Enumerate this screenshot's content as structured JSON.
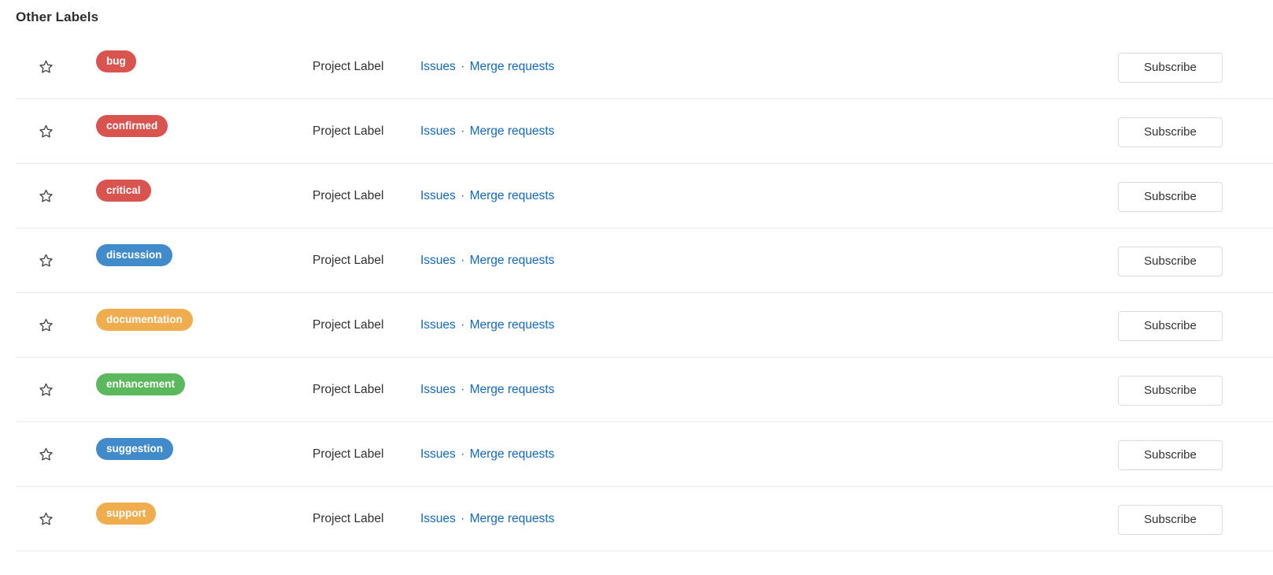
{
  "section": {
    "title": "Other Labels"
  },
  "colors": {
    "red": "#d9534f",
    "blue": "#428bca",
    "orange": "#f0ad4e",
    "green": "#5cb85c",
    "link": "#1068bf",
    "text": "#303030",
    "divider": "#e9e9e9",
    "button_border": "#dbdbdb"
  },
  "row_common": {
    "type_text": "Project Label",
    "issues_link": "Issues",
    "separator": "·",
    "merge_requests_link": "Merge requests",
    "subscribe_label": "Subscribe",
    "star_icon": "star-outline-icon",
    "promote_icon": "promote-arrow-up-icon",
    "edit_icon": "pencil-icon",
    "delete_icon": "trash-icon"
  },
  "labels": [
    {
      "name": "bug",
      "color": "#d9534f"
    },
    {
      "name": "confirmed",
      "color": "#d9534f"
    },
    {
      "name": "critical",
      "color": "#d9534f"
    },
    {
      "name": "discussion",
      "color": "#428bca"
    },
    {
      "name": "documentation",
      "color": "#f0ad4e"
    },
    {
      "name": "enhancement",
      "color": "#5cb85c"
    },
    {
      "name": "suggestion",
      "color": "#428bca"
    },
    {
      "name": "support",
      "color": "#f0ad4e"
    }
  ]
}
